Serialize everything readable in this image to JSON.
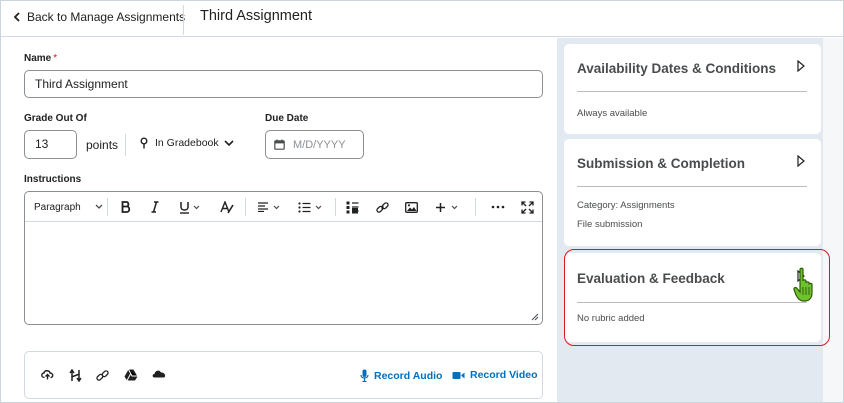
{
  "header": {
    "back_label": "Back to Manage Assignments",
    "title": "Third Assignment"
  },
  "form": {
    "name_label": "Name",
    "required_mark": "*",
    "name_value": "Third Assignment",
    "grade_label": "Grade Out Of",
    "grade_value": "13",
    "points_label": "points",
    "gradebook_label": "In Gradebook",
    "due_label": "Due Date",
    "due_placeholder": "M/D/YYYY",
    "instructions_label": "Instructions",
    "editor": {
      "paragraph_label": "Paragraph"
    },
    "attach": {
      "record_audio": "Record Audio",
      "record_video": "Record Video"
    }
  },
  "sidebar": {
    "cards": [
      {
        "title": "Availability Dates & Conditions",
        "lines": [
          "Always available"
        ]
      },
      {
        "title": "Submission & Completion",
        "lines": [
          "Category: Assignments",
          "File submission"
        ]
      },
      {
        "title": "Evaluation & Feedback",
        "lines": [
          "No rubric added"
        ]
      }
    ]
  },
  "colors": {
    "link_blue": "#006fbf",
    "highlight_red": "#d71920",
    "sidebar_bg": "#e3e9f1",
    "cursor_green": "#6ec22b"
  }
}
